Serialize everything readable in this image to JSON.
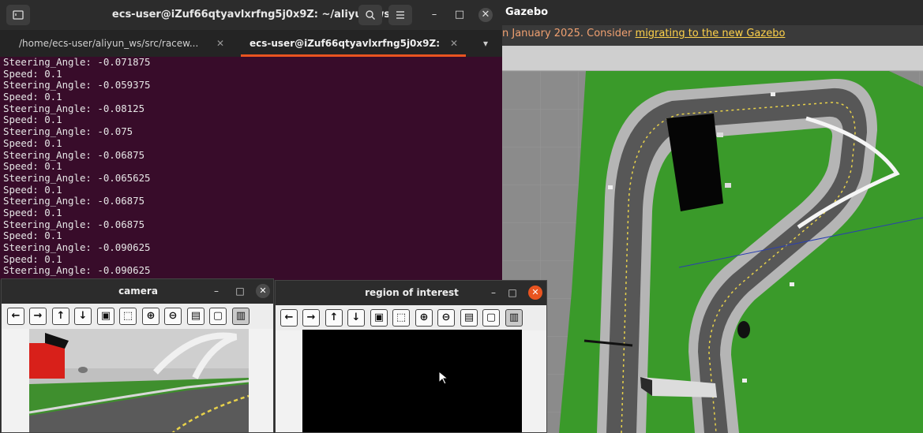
{
  "terminal": {
    "title": "ecs-user@iZuf66qtyavlxrfng5j0x9Z: ~/aliyun_ws",
    "tabs": [
      {
        "label": "/home/ecs-user/aliyun_ws/src/racew...",
        "active": false
      },
      {
        "label": "ecs-user@iZuf66qtyavlxrfng5j0x9Z: ~...",
        "active": true
      }
    ],
    "lines": [
      "Steering_Angle: -0.071875",
      "Speed: 0.1",
      "Steering_Angle: -0.059375",
      "Speed: 0.1",
      "Steering_Angle: -0.08125",
      "Speed: 0.1",
      "Steering_Angle: -0.075",
      "Speed: 0.1",
      "Steering_Angle: -0.06875",
      "Speed: 0.1",
      "Steering_Angle: -0.065625",
      "Speed: 0.1",
      "Steering_Angle: -0.06875",
      "Speed: 0.1",
      "Steering_Angle: -0.06875",
      "Speed: 0.1",
      "Steering_Angle: -0.090625",
      "Speed: 0.1",
      "Steering_Angle: -0.090625"
    ],
    "icons": {
      "terminal": "terminal-icon",
      "search": "search-icon",
      "menu": "menu-icon"
    },
    "controls": {
      "minimize": "–",
      "maximize": "□",
      "close": "✕"
    },
    "tab_close": "✕",
    "tab_menu": "▾"
  },
  "gazebo": {
    "title": "Gazebo",
    "banner_text": "n January 2025. Consider ",
    "banner_link": "migrating to the new Gazebo",
    "colors": {
      "grass": "#3a9a2a",
      "track": "#5a5a5a",
      "curb": "#b8b8b8",
      "lane_line": "#e8d24a",
      "ground": "#8a8a8a"
    }
  },
  "camera_window": {
    "title": "camera",
    "controls": {
      "minimize": "–",
      "maximize": "□",
      "close": "✕"
    }
  },
  "roi_window": {
    "title": "region of interest",
    "controls": {
      "minimize": "–",
      "maximize": "□",
      "close": "✕"
    }
  },
  "viewer_toolbar": [
    {
      "name": "back-button",
      "glyph": "←"
    },
    {
      "name": "forward-button",
      "glyph": "→"
    },
    {
      "name": "up-button",
      "glyph": "↑"
    },
    {
      "name": "down-button",
      "glyph": "↓"
    },
    {
      "name": "fit-button",
      "glyph": "▣"
    },
    {
      "name": "zoom-rect-button",
      "glyph": "⬚"
    },
    {
      "name": "zoom-in-button",
      "glyph": "⊕"
    },
    {
      "name": "zoom-out-button",
      "glyph": "⊖"
    },
    {
      "name": "save-button",
      "glyph": "▤"
    },
    {
      "name": "copy-button",
      "glyph": "▢"
    },
    {
      "name": "properties-button",
      "glyph": "▥"
    }
  ]
}
